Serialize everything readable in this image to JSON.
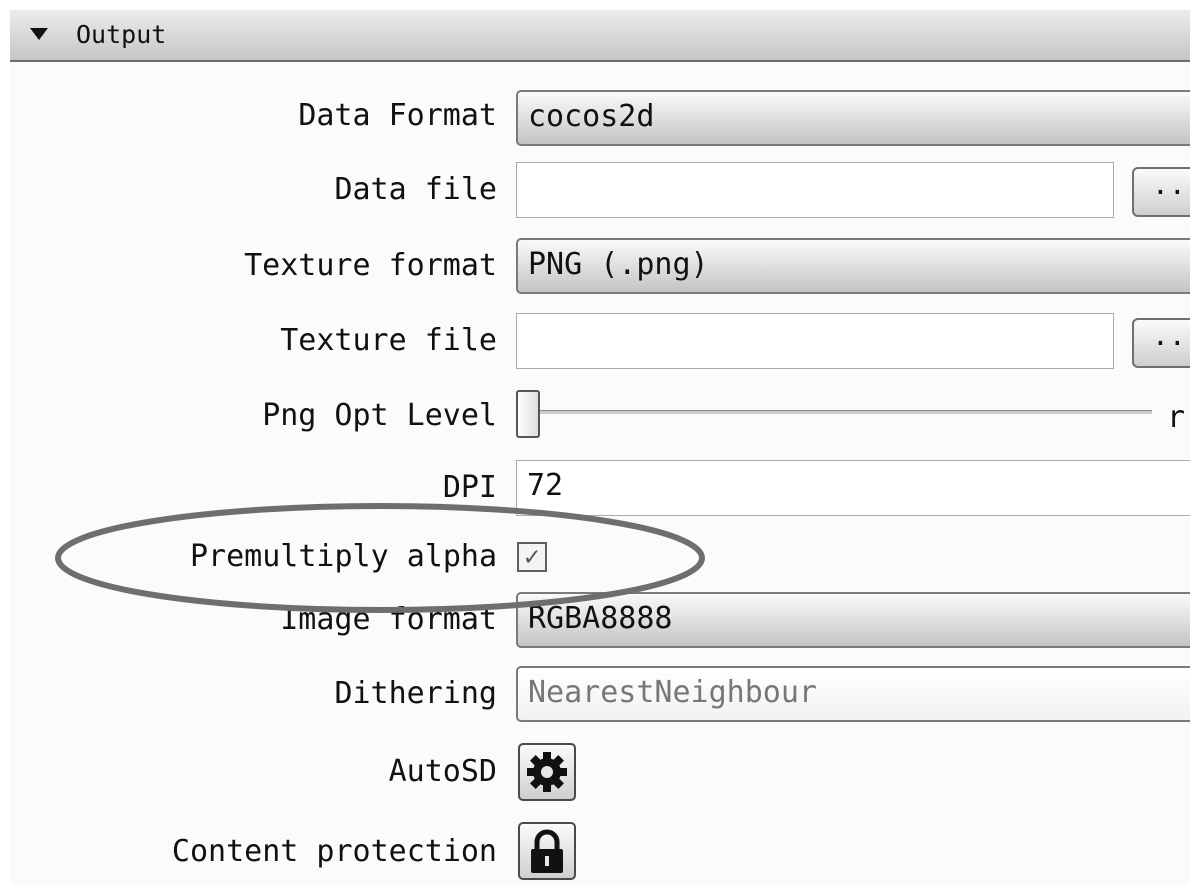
{
  "panel": {
    "title": "Output"
  },
  "fields": {
    "data_format": {
      "label": "Data Format",
      "value": "cocos2d"
    },
    "data_file": {
      "label": "Data file",
      "value": "",
      "browse_label": "..."
    },
    "texture_format": {
      "label": "Texture format",
      "value": "PNG (.png)"
    },
    "texture_file": {
      "label": "Texture file",
      "value": "",
      "browse_label": "..."
    },
    "png_opt_level": {
      "label": "Png Opt Level",
      "value_partial": "r"
    },
    "dpi": {
      "label": "DPI",
      "value": "72"
    },
    "premultiply_alpha": {
      "label": "Premultiply alpha",
      "checked": true,
      "check_glyph": "✓"
    },
    "image_format": {
      "label": "Image format",
      "value": "RGBA8888"
    },
    "dithering": {
      "label": "Dithering",
      "value": "NearestNeighbour",
      "disabled": true
    },
    "auto_sd": {
      "label": "AutoSD",
      "icon": "gear-icon"
    },
    "content_protection": {
      "label": "Content protection",
      "icon": "lock-icon"
    }
  },
  "annotation": {
    "type": "ellipse",
    "target": "premultiply_alpha",
    "color": "#6e6e6e"
  }
}
